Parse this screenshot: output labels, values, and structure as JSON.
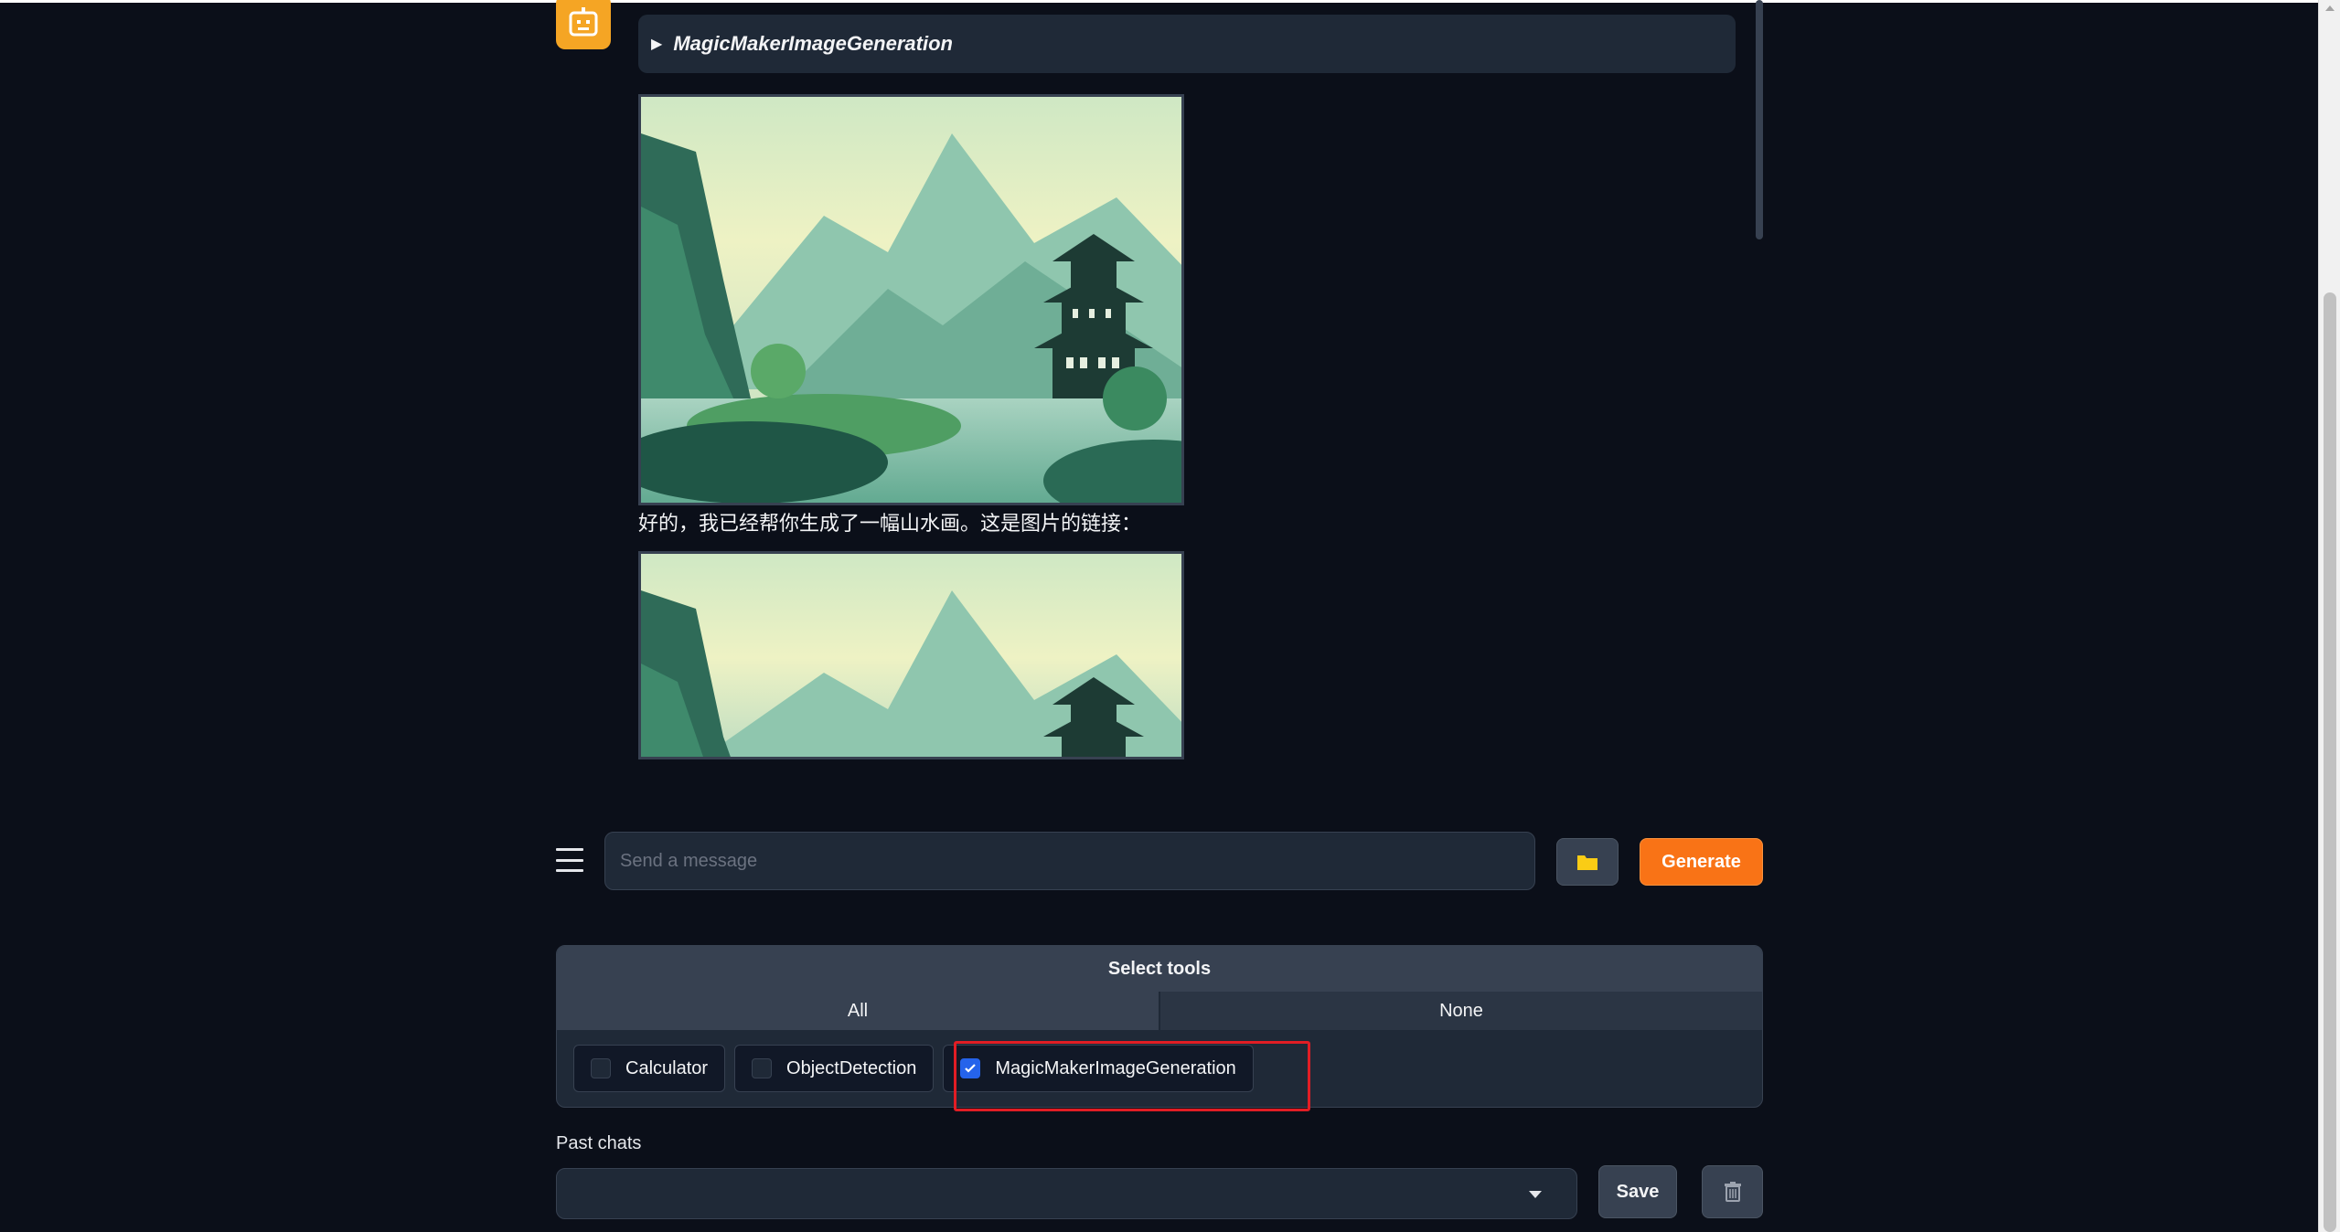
{
  "chat": {
    "tool_accordion_label": "MagicMakerImageGeneration",
    "bot_message": "好的，我已经帮你生成了一幅山水画。这是图片的链接："
  },
  "input": {
    "placeholder": "Send a message",
    "generate_label": "Generate"
  },
  "tools": {
    "header": "Select tools",
    "tab_all": "All",
    "tab_none": "None",
    "items": [
      {
        "label": "Calculator",
        "checked": false
      },
      {
        "label": "ObjectDetection",
        "checked": false
      },
      {
        "label": "MagicMakerImageGeneration",
        "checked": true
      }
    ]
  },
  "past_chats": {
    "label": "Past chats",
    "selected": "",
    "save_label": "Save"
  },
  "colors": {
    "background": "#0b0f19",
    "panel": "#1f2937",
    "accent": "#f97316",
    "checkbox_checked": "#2563eb",
    "highlight": "#e11d24",
    "avatar": "#f5a524"
  },
  "icons": {
    "avatar": "robot-icon",
    "menu": "menu-icon",
    "upload": "folder-icon",
    "delete": "trash-icon",
    "accordion": "triangle-right-icon"
  }
}
